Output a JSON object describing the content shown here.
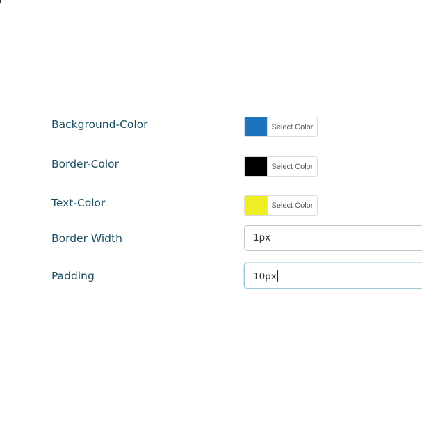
{
  "settings": {
    "background_color": {
      "label": "Background-Color",
      "button_label": "Select Color",
      "value": "#1e73be"
    },
    "border_color": {
      "label": "Border-Color",
      "button_label": "Select Color",
      "value": "#000000"
    },
    "text_color": {
      "label": "Text-Color",
      "button_label": "Select Color",
      "value": "#eeee22"
    },
    "border_width": {
      "label": "Border Width",
      "value": "1px"
    },
    "padding": {
      "label": "Padding",
      "value": "10px"
    }
  }
}
